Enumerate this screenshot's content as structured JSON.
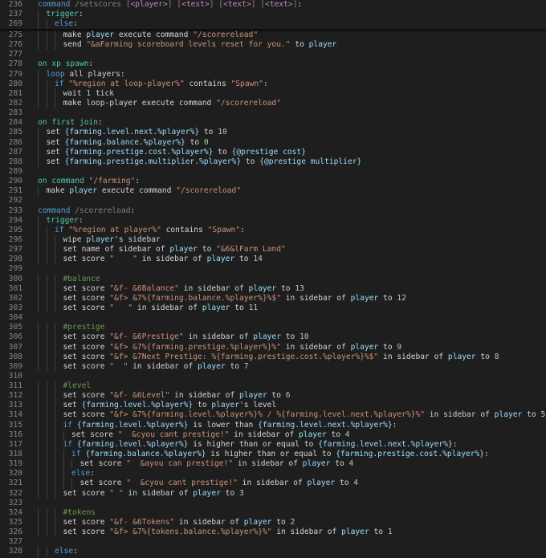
{
  "editor": {
    "theme_colors": {
      "background": "#1e1e1e",
      "line_number": "#858585",
      "keyword": "#569cd6",
      "event": "#4ec9b0",
      "string": "#ce9178",
      "expression": "#9cdcfe",
      "number": "#b5cea8",
      "comment": "#6a9955"
    },
    "sticky_lines": [
      {
        "n": "236",
        "indent": 0,
        "tokens": [
          [
            "kw",
            "command "
          ],
          [
            "gr",
            "/setscores ["
          ],
          [
            "ph",
            "<player>"
          ],
          [
            "gr",
            "] ["
          ],
          [
            "ph",
            "<text>"
          ],
          [
            "gr",
            "] ["
          ],
          [
            "ph",
            "<text>"
          ],
          [
            "gr",
            "] ["
          ],
          [
            "ph",
            "<text>"
          ],
          [
            "gr",
            "]"
          ],
          [
            "code",
            ":"
          ]
        ]
      },
      {
        "n": "237",
        "indent": 1,
        "tokens": [
          [
            "ev",
            "trigger"
          ],
          [
            "code",
            ":"
          ]
        ]
      },
      {
        "n": "269",
        "indent": 2,
        "tokens": [
          [
            "kw",
            "else"
          ],
          [
            "code",
            ":"
          ]
        ]
      }
    ],
    "lines": [
      {
        "n": "275",
        "indent": 3,
        "tokens": [
          [
            "code",
            "make "
          ],
          [
            "exp",
            "player"
          ],
          [
            "code",
            " execute command "
          ],
          [
            "str",
            "\"/scorereload\""
          ]
        ]
      },
      {
        "n": "276",
        "indent": 3,
        "tokens": [
          [
            "code",
            "send "
          ],
          [
            "str",
            "\"&aFarming scoreboard levels reset for you.\""
          ],
          [
            "code",
            " to "
          ],
          [
            "exp",
            "player"
          ]
        ]
      },
      {
        "n": "277",
        "indent": 0,
        "tokens": []
      },
      {
        "n": "278",
        "indent": 0,
        "tokens": [
          [
            "ev",
            "on xp spawn"
          ],
          [
            "code",
            ":"
          ]
        ]
      },
      {
        "n": "279",
        "indent": 1,
        "tokens": [
          [
            "kw",
            "loop "
          ],
          [
            "code",
            "all players:"
          ]
        ]
      },
      {
        "n": "280",
        "indent": 2,
        "tokens": [
          [
            "kw",
            "if "
          ],
          [
            "str",
            "\"%region at loop-player%\""
          ],
          [
            "code",
            " contains "
          ],
          [
            "str",
            "\"Spawn\""
          ],
          [
            "code",
            ":"
          ]
        ]
      },
      {
        "n": "281",
        "indent": 3,
        "tokens": [
          [
            "code",
            "wait "
          ],
          [
            "num",
            "1"
          ],
          [
            "code",
            " tick"
          ]
        ]
      },
      {
        "n": "282",
        "indent": 3,
        "tokens": [
          [
            "code",
            "make loop-player execute command "
          ],
          [
            "str",
            "\"/scorereload\""
          ]
        ]
      },
      {
        "n": "283",
        "indent": 0,
        "tokens": []
      },
      {
        "n": "284",
        "indent": 0,
        "tokens": [
          [
            "ev",
            "on first join"
          ],
          [
            "code",
            ":"
          ]
        ]
      },
      {
        "n": "285",
        "indent": 1,
        "tokens": [
          [
            "code",
            "set "
          ],
          [
            "exp",
            "{farming.level.next.%player%}"
          ],
          [
            "code",
            " to "
          ],
          [
            "num",
            "10"
          ]
        ]
      },
      {
        "n": "286",
        "indent": 1,
        "tokens": [
          [
            "code",
            "set "
          ],
          [
            "exp",
            "{farming.balance.%player%}"
          ],
          [
            "code",
            " to "
          ],
          [
            "num",
            "0"
          ]
        ]
      },
      {
        "n": "287",
        "indent": 1,
        "tokens": [
          [
            "code",
            "set "
          ],
          [
            "exp",
            "{farming.prestige.cost.%player%}"
          ],
          [
            "code",
            " to "
          ],
          [
            "exp",
            "{@prestige cost}"
          ]
        ]
      },
      {
        "n": "288",
        "indent": 1,
        "tokens": [
          [
            "code",
            "set "
          ],
          [
            "exp",
            "{farming.prestige.multiplier.%player%}"
          ],
          [
            "code",
            " to "
          ],
          [
            "exp",
            "{@prestige multiplier}"
          ]
        ]
      },
      {
        "n": "289",
        "indent": 0,
        "tokens": []
      },
      {
        "n": "290",
        "indent": 0,
        "tokens": [
          [
            "ev",
            "on command "
          ],
          [
            "str",
            "\"/farming\""
          ],
          [
            "code",
            ":"
          ]
        ]
      },
      {
        "n": "291",
        "indent": 1,
        "tokens": [
          [
            "code",
            "make "
          ],
          [
            "exp",
            "player"
          ],
          [
            "code",
            " execute command "
          ],
          [
            "str",
            "\"/scorereload\""
          ]
        ]
      },
      {
        "n": "292",
        "indent": 0,
        "tokens": []
      },
      {
        "n": "293",
        "indent": 0,
        "tokens": [
          [
            "kw",
            "command "
          ],
          [
            "gr",
            "/scorereload"
          ],
          [
            "code",
            ":"
          ]
        ]
      },
      {
        "n": "294",
        "indent": 1,
        "tokens": [
          [
            "ev",
            "trigger"
          ],
          [
            "code",
            ":"
          ]
        ]
      },
      {
        "n": "295",
        "indent": 2,
        "tokens": [
          [
            "kw",
            "if "
          ],
          [
            "str",
            "\"%region at player%\""
          ],
          [
            "code",
            " contains "
          ],
          [
            "str",
            "\"Spawn\""
          ],
          [
            "code",
            ":"
          ]
        ]
      },
      {
        "n": "296",
        "indent": 3,
        "tokens": [
          [
            "code",
            "wipe "
          ],
          [
            "exp",
            "player"
          ],
          [
            "code",
            "'s sidebar"
          ]
        ]
      },
      {
        "n": "297",
        "indent": 3,
        "tokens": [
          [
            "code",
            "set name of sidebar of "
          ],
          [
            "exp",
            "player"
          ],
          [
            "code",
            " to "
          ],
          [
            "str",
            "\"&6&lFarm Land\""
          ]
        ]
      },
      {
        "n": "298",
        "indent": 3,
        "tokens": [
          [
            "code",
            "set score "
          ],
          [
            "str",
            "\"    \""
          ],
          [
            "code",
            " in sidebar of "
          ],
          [
            "exp",
            "player"
          ],
          [
            "code",
            " to "
          ],
          [
            "num",
            "14"
          ]
        ]
      },
      {
        "n": "299",
        "indent": 0,
        "tokens": []
      },
      {
        "n": "300",
        "indent": 3,
        "tokens": [
          [
            "cmt",
            "#balance"
          ]
        ]
      },
      {
        "n": "301",
        "indent": 3,
        "tokens": [
          [
            "code",
            "set score "
          ],
          [
            "str",
            "\"&f- &6Balance\""
          ],
          [
            "code",
            " in sidebar of "
          ],
          [
            "exp",
            "player"
          ],
          [
            "code",
            " to "
          ],
          [
            "num",
            "13"
          ]
        ]
      },
      {
        "n": "302",
        "indent": 3,
        "tokens": [
          [
            "code",
            "set score "
          ],
          [
            "str",
            "\"&f> &7%{farming.balance.%player%}%$\""
          ],
          [
            "code",
            " in sidebar of "
          ],
          [
            "exp",
            "player"
          ],
          [
            "code",
            " to "
          ],
          [
            "num",
            "12"
          ]
        ]
      },
      {
        "n": "303",
        "indent": 3,
        "tokens": [
          [
            "code",
            "set score "
          ],
          [
            "str",
            "\"   \""
          ],
          [
            "code",
            " in sidebar of "
          ],
          [
            "exp",
            "player"
          ],
          [
            "code",
            " to "
          ],
          [
            "num",
            "11"
          ]
        ]
      },
      {
        "n": "304",
        "indent": 0,
        "tokens": []
      },
      {
        "n": "305",
        "indent": 3,
        "tokens": [
          [
            "cmt",
            "#prestige"
          ]
        ]
      },
      {
        "n": "306",
        "indent": 3,
        "tokens": [
          [
            "code",
            "set score "
          ],
          [
            "str",
            "\"&f- &6Prestige\""
          ],
          [
            "code",
            " in sidebar of "
          ],
          [
            "exp",
            "player"
          ],
          [
            "code",
            " to "
          ],
          [
            "num",
            "10"
          ]
        ]
      },
      {
        "n": "307",
        "indent": 3,
        "tokens": [
          [
            "code",
            "set score "
          ],
          [
            "str",
            "\"&f> &7%{farming.prestige.%player%}%\""
          ],
          [
            "code",
            " in sidebar of "
          ],
          [
            "exp",
            "player"
          ],
          [
            "code",
            " to "
          ],
          [
            "num",
            "9"
          ]
        ]
      },
      {
        "n": "308",
        "indent": 3,
        "tokens": [
          [
            "code",
            "set score "
          ],
          [
            "str",
            "\"&f> &7Next Prestige: %{farming.prestige.cost.%player%}%$\""
          ],
          [
            "code",
            " in sidebar of "
          ],
          [
            "exp",
            "player"
          ],
          [
            "code",
            " to "
          ],
          [
            "num",
            "8"
          ]
        ]
      },
      {
        "n": "309",
        "indent": 3,
        "tokens": [
          [
            "code",
            "set score "
          ],
          [
            "str",
            "\"  \""
          ],
          [
            "code",
            " in sidebar of "
          ],
          [
            "exp",
            "player"
          ],
          [
            "code",
            " to "
          ],
          [
            "num",
            "7"
          ]
        ]
      },
      {
        "n": "310",
        "indent": 0,
        "tokens": []
      },
      {
        "n": "311",
        "indent": 3,
        "tokens": [
          [
            "cmt",
            "#level"
          ]
        ]
      },
      {
        "n": "312",
        "indent": 3,
        "tokens": [
          [
            "code",
            "set score "
          ],
          [
            "str",
            "\"&f- &6Level\""
          ],
          [
            "code",
            " in sidebar of "
          ],
          [
            "exp",
            "player"
          ],
          [
            "code",
            " to "
          ],
          [
            "num",
            "6"
          ]
        ]
      },
      {
        "n": "313",
        "indent": 3,
        "tokens": [
          [
            "code",
            "set "
          ],
          [
            "exp",
            "{farming.level.%player%}"
          ],
          [
            "code",
            " to "
          ],
          [
            "exp",
            "player"
          ],
          [
            "code",
            "'s level"
          ]
        ]
      },
      {
        "n": "314",
        "indent": 3,
        "tokens": [
          [
            "code",
            "set score "
          ],
          [
            "str",
            "\"&f> &7%{farming.level.%player%}% / %{farming.level.next.%player%}%\""
          ],
          [
            "code",
            " in sidebar of "
          ],
          [
            "exp",
            "player"
          ],
          [
            "code",
            " to "
          ],
          [
            "num",
            "5"
          ]
        ]
      },
      {
        "n": "315",
        "indent": 3,
        "tokens": [
          [
            "kw",
            "if "
          ],
          [
            "exp",
            "{farming.level.%player%}"
          ],
          [
            "code",
            " is lower than "
          ],
          [
            "exp",
            "{farming.level.next.%player%}"
          ],
          [
            "code",
            ":"
          ]
        ]
      },
      {
        "n": "316",
        "indent": 4,
        "tokens": [
          [
            "code",
            "set score "
          ],
          [
            "str",
            "\"  &cyou cant prestige!\""
          ],
          [
            "code",
            " in sidebar of "
          ],
          [
            "exp",
            "player"
          ],
          [
            "code",
            " to "
          ],
          [
            "num",
            "4"
          ]
        ]
      },
      {
        "n": "317",
        "indent": 3,
        "tokens": [
          [
            "kw",
            "if "
          ],
          [
            "exp",
            "{farming.level.%player%}"
          ],
          [
            "code",
            " is higher than or equal to "
          ],
          [
            "exp",
            "{farming.level.next.%player%}"
          ],
          [
            "code",
            ":"
          ]
        ]
      },
      {
        "n": "318",
        "indent": 4,
        "tokens": [
          [
            "kw",
            "if "
          ],
          [
            "exp",
            "{farming.balance.%player%}"
          ],
          [
            "code",
            " is higher than or equal to "
          ],
          [
            "exp",
            "{farming.prestige.cost.%player%}"
          ],
          [
            "code",
            ":"
          ]
        ]
      },
      {
        "n": "319",
        "indent": 5,
        "tokens": [
          [
            "code",
            "set score "
          ],
          [
            "str",
            "\"  &ayou can prestige!\""
          ],
          [
            "code",
            " in sidebar of "
          ],
          [
            "exp",
            "player"
          ],
          [
            "code",
            " to "
          ],
          [
            "num",
            "4"
          ]
        ]
      },
      {
        "n": "320",
        "indent": 4,
        "tokens": [
          [
            "kw",
            "else"
          ],
          [
            "code",
            ":"
          ]
        ]
      },
      {
        "n": "321",
        "indent": 5,
        "tokens": [
          [
            "code",
            "set score "
          ],
          [
            "str",
            "\"  &cyou cant prestige!\""
          ],
          [
            "code",
            " in sidebar of "
          ],
          [
            "exp",
            "player"
          ],
          [
            "code",
            " to "
          ],
          [
            "num",
            "4"
          ]
        ]
      },
      {
        "n": "322",
        "indent": 3,
        "tokens": [
          [
            "code",
            "set score "
          ],
          [
            "str",
            "\" \""
          ],
          [
            "code",
            " in sidebar of "
          ],
          [
            "exp",
            "player"
          ],
          [
            "code",
            " to "
          ],
          [
            "num",
            "3"
          ]
        ]
      },
      {
        "n": "323",
        "indent": 0,
        "tokens": []
      },
      {
        "n": "324",
        "indent": 3,
        "tokens": [
          [
            "cmt",
            "#tokens"
          ]
        ]
      },
      {
        "n": "325",
        "indent": 3,
        "tokens": [
          [
            "code",
            "set score "
          ],
          [
            "str",
            "\"&f- &6Tokens\""
          ],
          [
            "code",
            " in sidebar of "
          ],
          [
            "exp",
            "player"
          ],
          [
            "code",
            " to "
          ],
          [
            "num",
            "2"
          ]
        ]
      },
      {
        "n": "326",
        "indent": 3,
        "tokens": [
          [
            "code",
            "set score "
          ],
          [
            "str",
            "\"&f> &7%{tokens.balance.%player%}%\""
          ],
          [
            "code",
            " in sidebar of "
          ],
          [
            "exp",
            "player"
          ],
          [
            "code",
            " to "
          ],
          [
            "num",
            "1"
          ]
        ]
      },
      {
        "n": "327",
        "indent": 0,
        "tokens": []
      },
      {
        "n": "328",
        "indent": 2,
        "tokens": [
          [
            "kw",
            "else"
          ],
          [
            "code",
            ":"
          ]
        ]
      }
    ]
  }
}
